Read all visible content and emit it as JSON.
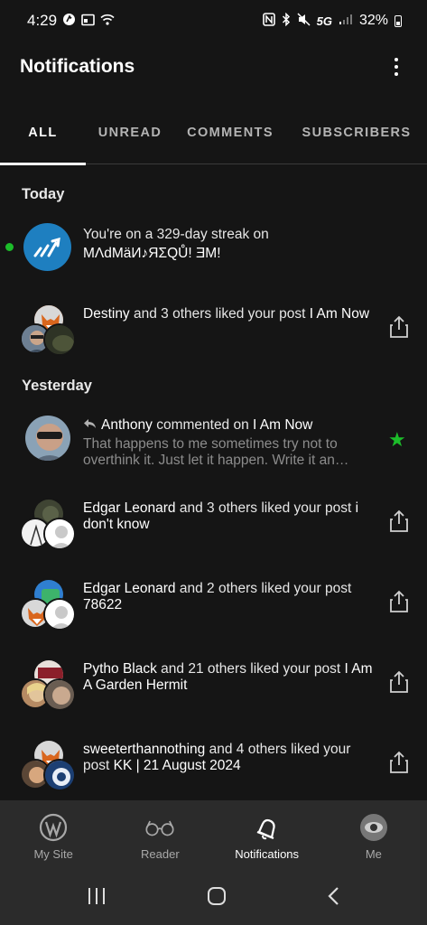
{
  "status_bar": {
    "time": "4:29",
    "network": "5G",
    "battery": "32%"
  },
  "header": {
    "title": "Notifications",
    "menu_icon": "more-vertical-icon"
  },
  "tabs": [
    {
      "label": "ALL",
      "active": true
    },
    {
      "label": "UNREAD",
      "active": false
    },
    {
      "label": "COMMENTS",
      "active": false
    },
    {
      "label": "SUBSCRIBERS",
      "active": false
    }
  ],
  "sections": {
    "today": "Today",
    "yesterday": "Yesterday"
  },
  "notifications": [
    {
      "prefix": "You're on a 329-day streak on ",
      "name": "MΛdMäИ♪ЯΣQŮ! ƎM!",
      "suffix": "",
      "unread": true
    },
    {
      "name": "Destiny",
      "text": " and 3 others liked your post ",
      "post": "I Am Now"
    },
    {
      "name": "Anthony",
      "text": " commented on ",
      "post": "I Am Now",
      "excerpt": "That happens to me sometimes try not to overthink it. Just let it happen. Write it an…"
    },
    {
      "name": "Edgar Leonard",
      "text": " and 3 others liked your post ",
      "post": "i don't know"
    },
    {
      "name": "Edgar Leonard",
      "text": " and 2 others liked your post ",
      "post": "78622"
    },
    {
      "name": "Pytho Black",
      "text": " and 21 others liked your post ",
      "post": "I Am A Garden Hermit"
    },
    {
      "name": "sweeterthannothing",
      "text": " and 4 others liked your post ",
      "post": "KK | 21 August 2024"
    }
  ],
  "bottom_nav": [
    {
      "label": "My Site",
      "icon": "wordpress-icon"
    },
    {
      "label": "Reader",
      "icon": "glasses-icon"
    },
    {
      "label": "Notifications",
      "icon": "bell-icon",
      "active": true
    },
    {
      "label": "Me",
      "icon": "avatar-icon"
    }
  ],
  "colors": {
    "accent_green": "#1cbd2a",
    "background": "#151515",
    "nav_bg": "#2b2b2b"
  }
}
